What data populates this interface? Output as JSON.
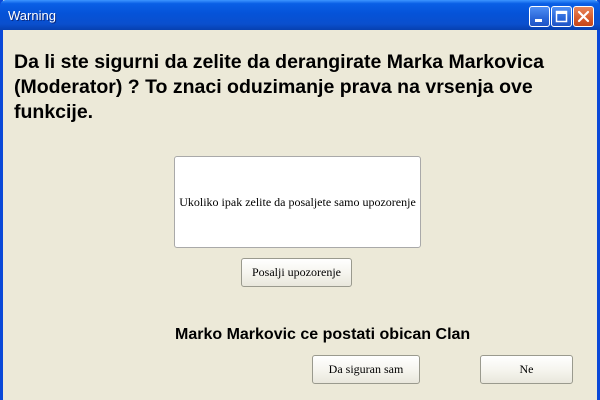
{
  "window": {
    "title": "Warning"
  },
  "dialog": {
    "message": "Da li ste sigurni da zelite da derangirate Marka Markovica (Moderator) ?  To znaci oduzimanje prava na vrsenja ove funkcije.",
    "note": "Ukoliko ipak zelite da posaljete samo upozorenje",
    "send_warning_label": "Posalji upozorenje",
    "status": "Marko Markovic ce postati obican Clan",
    "confirm_label": "Da siguran sam",
    "cancel_label": "Ne"
  },
  "icons": {
    "minimize": "minimize-icon",
    "maximize": "maximize-icon",
    "close": "close-icon"
  },
  "colors": {
    "titlebar": "#0553d8",
    "dialog_bg": "#ece9d8",
    "close_button": "#d75a2a"
  }
}
